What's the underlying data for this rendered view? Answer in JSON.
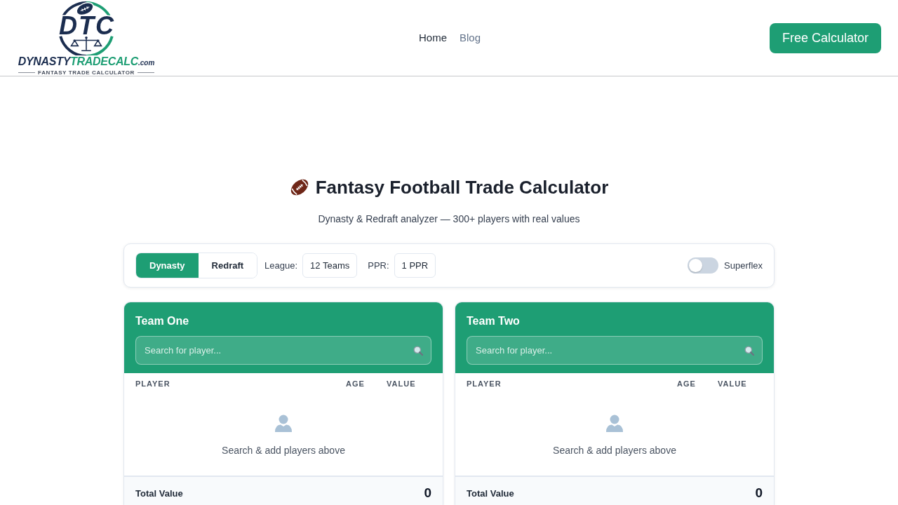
{
  "header": {
    "logo": {
      "monogram": "DTC",
      "wordmark": [
        {
          "text": "DYNASTY",
          "kind": "primary"
        },
        {
          "text": "TRADECALC",
          "kind": "accent"
        },
        {
          "text": ".com",
          "kind": "domain"
        }
      ],
      "tagline": "FANTASY TRADE CALCULATOR"
    },
    "nav": [
      {
        "label": "Home",
        "selected": true
      },
      {
        "label": "Blog",
        "selected": false
      }
    ],
    "cta": "Free Calculator"
  },
  "hero": {
    "title": "Fantasy Football Trade Calculator",
    "subtitle": "Dynasty & Redraft analyzer — 300+ players with real values"
  },
  "settings": {
    "modes": [
      {
        "label": "Dynasty",
        "selected": true
      },
      {
        "label": "Redraft",
        "selected": false
      }
    ],
    "fields": [
      {
        "label": "League:",
        "value": "12 Teams"
      },
      {
        "label": "PPR:",
        "value": "1 PPR"
      }
    ],
    "superflex": {
      "label": "Superflex",
      "on": false
    }
  },
  "teams": [
    {
      "title": "Team One",
      "search": {
        "placeholder": "Search for player..."
      },
      "columns": [
        "PLAYER",
        "AGE",
        "VALUE"
      ],
      "empty_message": "Search & add players above",
      "total_label": "Total Value",
      "total": "0"
    },
    {
      "title": "Team Two",
      "search": {
        "placeholder": "Search for player..."
      },
      "columns": [
        "PLAYER",
        "AGE",
        "VALUE"
      ],
      "empty_message": "Search & add players above",
      "total_label": "Total Value",
      "total": "0"
    }
  ]
}
